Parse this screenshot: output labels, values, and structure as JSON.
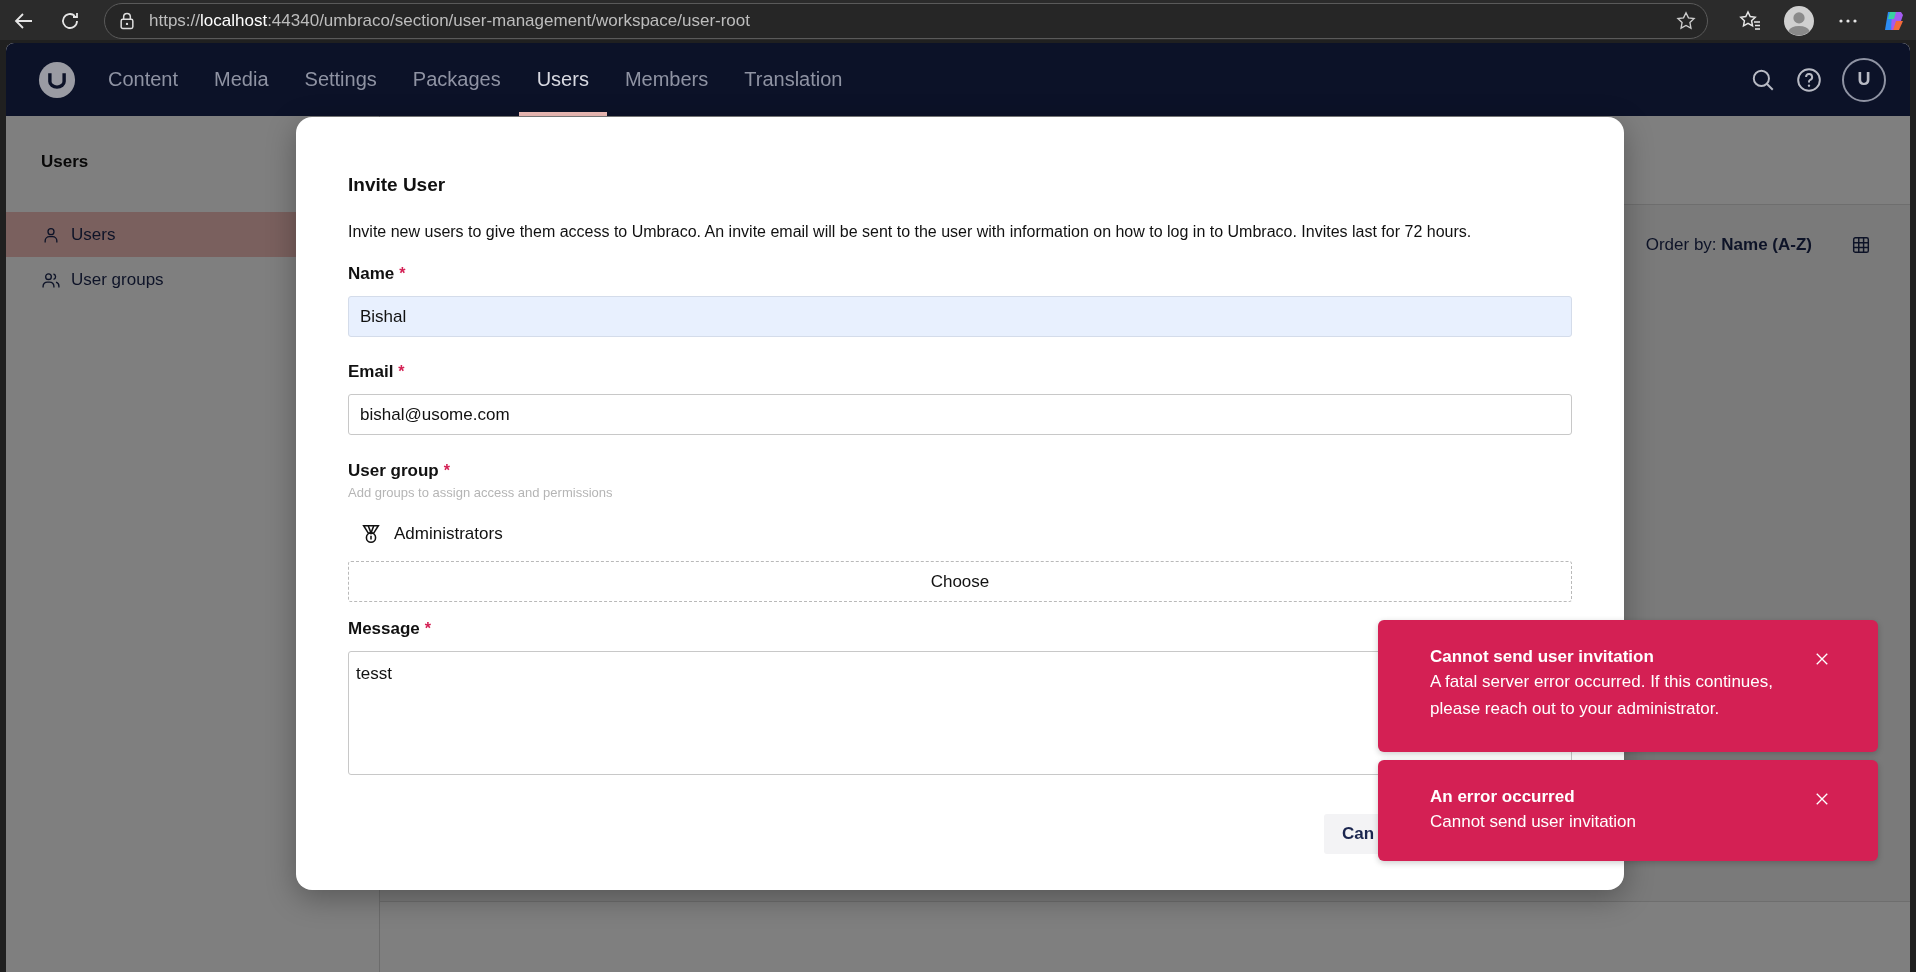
{
  "browser": {
    "url_prefix": "https://",
    "url_host": "localhost",
    "url_suffix": ":44340/umbraco/section/user-management/workspace/user-root"
  },
  "header": {
    "nav": [
      {
        "label": "Content",
        "selected": false
      },
      {
        "label": "Media",
        "selected": false
      },
      {
        "label": "Settings",
        "selected": false
      },
      {
        "label": "Packages",
        "selected": false
      },
      {
        "label": "Users",
        "selected": true
      },
      {
        "label": "Members",
        "selected": false
      },
      {
        "label": "Translation",
        "selected": false
      }
    ],
    "avatar_initial": "U"
  },
  "sidebar": {
    "title": "Users",
    "items": [
      {
        "label": "Users",
        "kind": "user",
        "selected": true
      },
      {
        "label": "User groups",
        "kind": "group",
        "selected": false
      }
    ]
  },
  "main": {
    "order_by": "Order by: **Name (A-Z)**"
  },
  "modal": {
    "title": "Invite User",
    "description": "Invite new users to give them access to Umbraco. An invite email will be sent to the user with information on how to log in to Umbraco. Invites last for 72 hours.",
    "fields": [
      {
        "kind": "text",
        "label": "Name",
        "required_mark": "*",
        "value": "Bishal",
        "autofilled": true
      },
      {
        "kind": "text",
        "label": "Email",
        "required_mark": "*",
        "value": "bishal@usome.com",
        "autofilled": false
      },
      {
        "kind": "groups",
        "label": "User group",
        "required_mark": "*",
        "hint": "Add groups to assign access and permissions",
        "groups": [
          {
            "name": "Administrators"
          }
        ],
        "choose_label": "Choose"
      },
      {
        "kind": "textarea",
        "label": "Message",
        "required_mark": "*",
        "value": "tesst"
      }
    ],
    "buttons": [
      {
        "label": "Can"
      }
    ]
  },
  "toasts": [
    {
      "title": "Cannot send user invitation",
      "message": "A fatal server error occurred. If this continues, please reach out to your administrator."
    },
    {
      "title": "An error occurred",
      "message": "Cannot send user invitation"
    }
  ]
}
